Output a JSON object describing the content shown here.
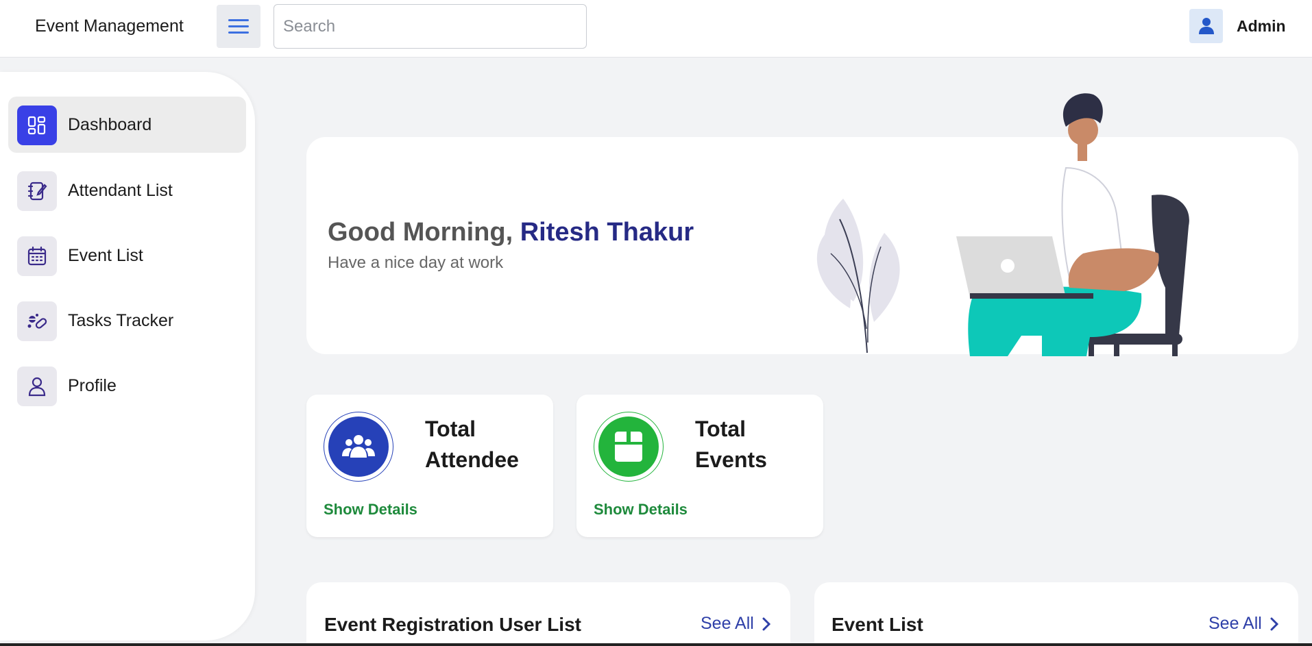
{
  "app": {
    "title": "Event Management"
  },
  "header": {
    "search_placeholder": "Search",
    "user_name": "Admin"
  },
  "sidebar": {
    "items": [
      {
        "label": "Dashboard",
        "icon": "dashboard-icon",
        "active": true
      },
      {
        "label": "Attendant List",
        "icon": "notebook-edit-icon",
        "active": false
      },
      {
        "label": "Event List",
        "icon": "calendar-icon",
        "active": false
      },
      {
        "label": "Tasks Tracker",
        "icon": "pills-icon",
        "active": false
      },
      {
        "label": "Profile",
        "icon": "user-icon",
        "active": false
      }
    ]
  },
  "welcome": {
    "greeting": "Good Morning,",
    "user": "Ritesh Thakur",
    "subtitle": "Have a nice day at work"
  },
  "stats": [
    {
      "title": "Total Attendee",
      "link": "Show Details",
      "icon": "users-group-icon",
      "color": "#2641b8"
    },
    {
      "title": "Total Events",
      "link": "Show Details",
      "icon": "box-icon",
      "color": "#23b43c"
    }
  ],
  "lists": [
    {
      "title": "Event Registration User List",
      "action": "See All"
    },
    {
      "title": "Event List",
      "action": "See All"
    }
  ],
  "colors": {
    "accent": "#3940e6",
    "name": "#262a85",
    "link_green": "#1e8a3c",
    "see_all": "#2f40a8"
  }
}
